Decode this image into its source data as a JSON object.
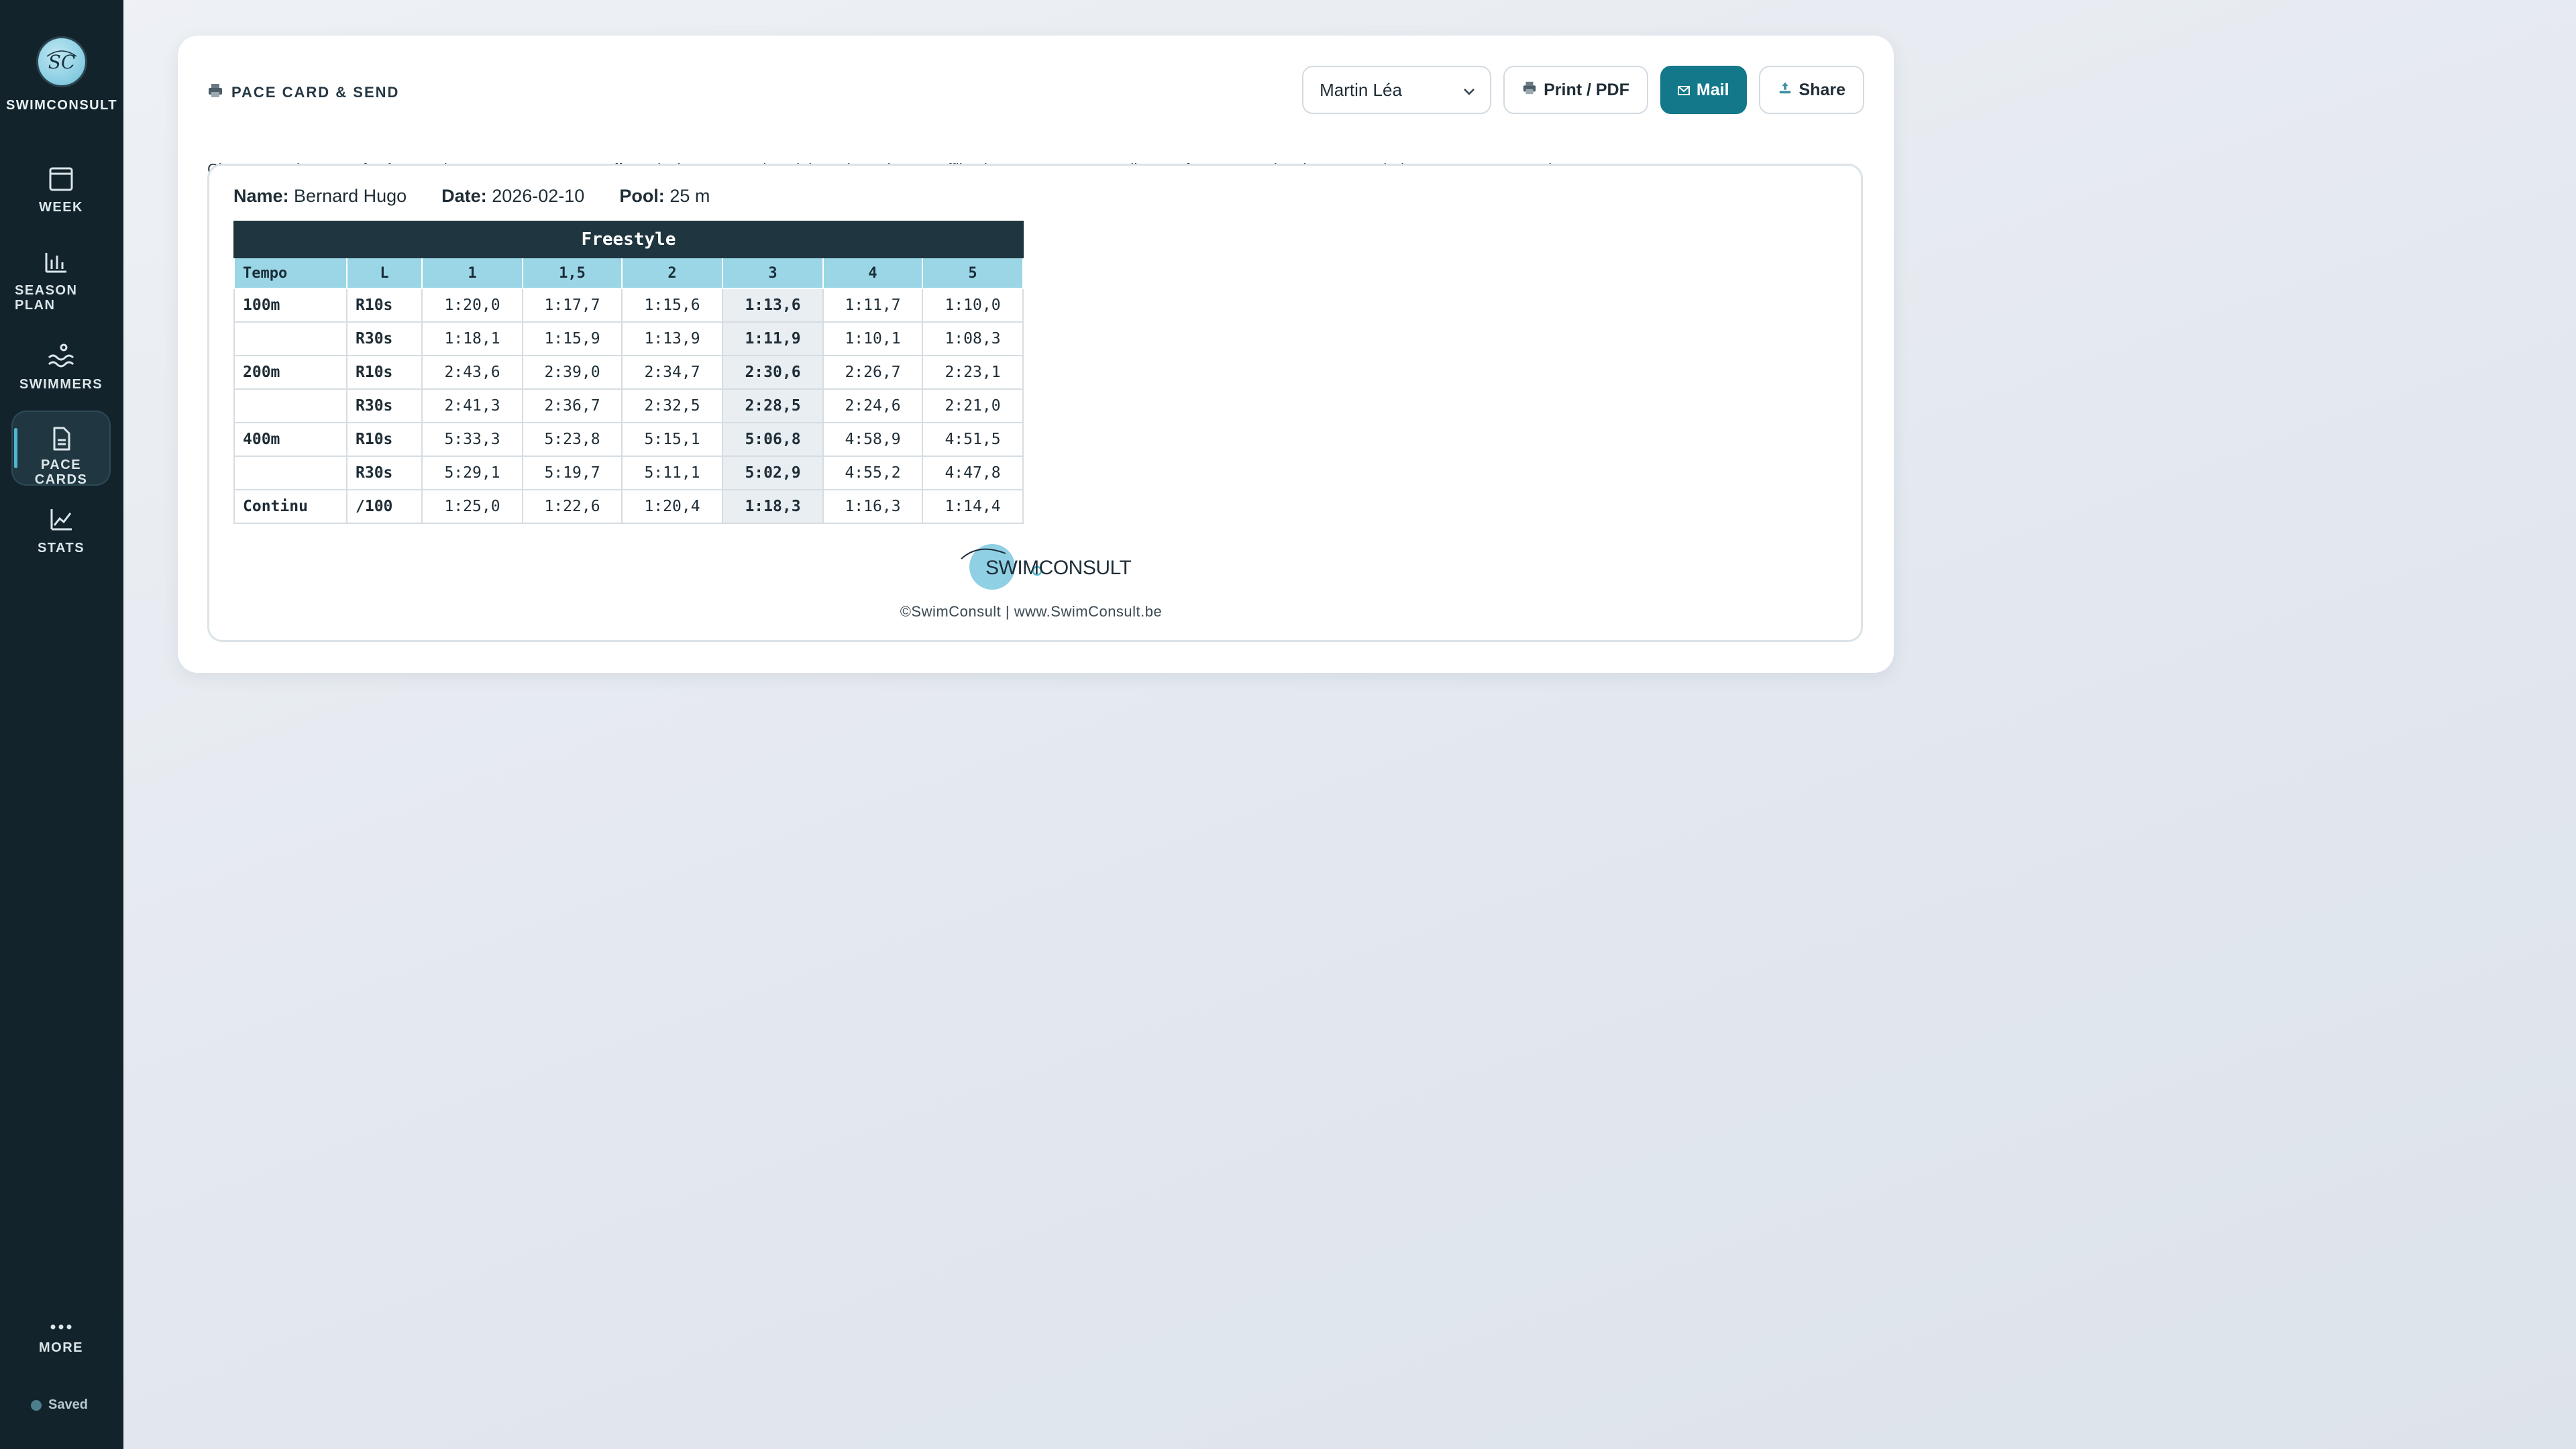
{
  "brand": {
    "name": "SWIMCONSULT",
    "logo_text": "SC"
  },
  "nav": {
    "week": "WEEK",
    "season_plan_line1": "SEASON",
    "season_plan_line2": "PLAN",
    "swimmers": "SWIMMERS",
    "pace_cards": "PACE CARDS",
    "stats": "STATS",
    "more": "MORE",
    "active": "pace_cards"
  },
  "status": {
    "saved": "Saved"
  },
  "card": {
    "title": "PACE CARD & SEND",
    "swimmer_select": "Martin Léa",
    "print_label": "Print / PDF",
    "mail_label": "Mail",
    "share_label": "Share",
    "help": {
      "t1": "Choose a swimmer. ",
      "b1": "Print / PDF",
      "t2": " prints or saves as PDF. ",
      "b2": "Mail",
      "t3": " sends the pace card straight to the swimmer; offline it opens your own mail app; ",
      "b3": "Share",
      "t4": " opens the share menu (WhatsApp, Messages...)."
    }
  },
  "pace_card": {
    "name_label": "Name:",
    "name": "Bernard Hugo",
    "date_label": "Date:",
    "date": "2026-02-10",
    "pool_label": "Pool:",
    "pool": "25 m",
    "table": {
      "title": "Freestyle",
      "columns": [
        "Tempo",
        "L",
        "1",
        "1,5",
        "2",
        "3",
        "4",
        "5"
      ],
      "rows": [
        {
          "dist": "100m",
          "rest": "R10s",
          "values": [
            "1:20,0",
            "1:17,7",
            "1:15,6",
            "1:13,6",
            "1:11,7",
            "1:10,0"
          ]
        },
        {
          "dist": "",
          "rest": "R30s",
          "values": [
            "1:18,1",
            "1:15,9",
            "1:13,9",
            "1:11,9",
            "1:10,1",
            "1:08,3"
          ]
        },
        {
          "dist": "200m",
          "rest": "R10s",
          "values": [
            "2:43,6",
            "2:39,0",
            "2:34,7",
            "2:30,6",
            "2:26,7",
            "2:23,1"
          ]
        },
        {
          "dist": "",
          "rest": "R30s",
          "values": [
            "2:41,3",
            "2:36,7",
            "2:32,5",
            "2:28,5",
            "2:24,6",
            "2:21,0"
          ]
        },
        {
          "dist": "400m",
          "rest": "R10s",
          "values": [
            "5:33,3",
            "5:23,8",
            "5:15,1",
            "5:06,8",
            "4:58,9",
            "4:51,5"
          ]
        },
        {
          "dist": "",
          "rest": "R30s",
          "values": [
            "5:29,1",
            "5:19,7",
            "5:11,1",
            "5:02,9",
            "4:55,2",
            "4:47,8"
          ]
        },
        {
          "dist": "Continu",
          "rest": "/100",
          "values": [
            "1:25,0",
            "1:22,6",
            "1:20,4",
            "1:18,3",
            "1:16,3",
            "1:14,4"
          ]
        }
      ]
    },
    "footer_logo": "SWIMCONSULT",
    "footer": "©SwimConsult  |  www.SwimConsult.be"
  },
  "colors": {
    "sidebar": "#13232b",
    "accent": "#13788a",
    "table_header": "#1f3640",
    "column_header": "#9bd6e6",
    "highlight_column": "#e8eef2"
  },
  "icons": {
    "week": "calendar-icon",
    "season_plan": "bar-chart-icon",
    "swimmers": "waves-icon",
    "pace_cards": "document-icon",
    "stats": "line-chart-icon",
    "more": "dots-icon",
    "print": "printer-icon",
    "mail": "envelope-icon",
    "share": "share-icon",
    "select": "chevron-down-icon"
  }
}
